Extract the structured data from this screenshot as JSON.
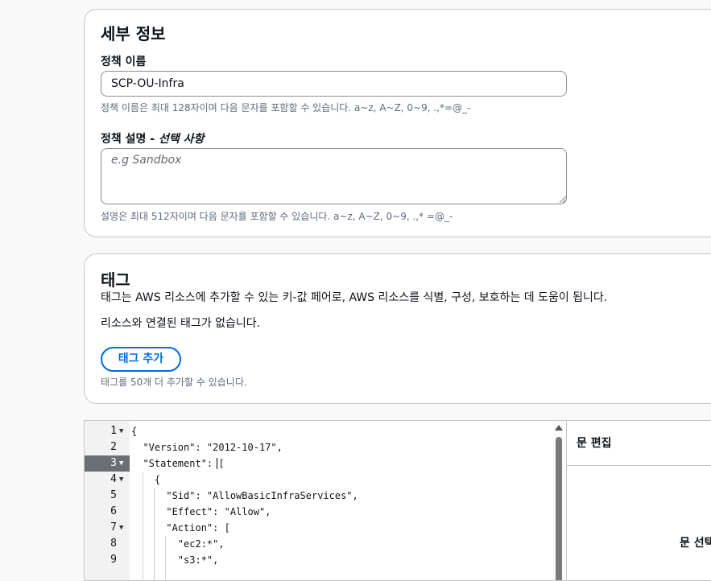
{
  "details": {
    "title": "세부 정보",
    "policy_name_label": "정책 이름",
    "policy_name_value": "SCP-OU-Infra",
    "policy_name_help": "정책 이름은 최대 128자이며 다음 문자를 포함할 수 있습니다. a~z, A~Z, 0~9, .,*=@_-",
    "description_label": "정책 설명 - ",
    "description_optional": "선택 사항",
    "description_placeholder": "e.g Sandbox",
    "description_help": "설명은 최대 512자이며 다음 문자를 포함할 수 있습니다. a~z, A~Z, 0~9, .,* =@_-"
  },
  "tags": {
    "title": "태그",
    "description": "태그는 AWS 리소스에 추가할 수 있는 키-값 페어로, AWS 리소스를 식별, 구성, 보호하는 데 도움이 됩니다.",
    "empty_text": "리소스와 연결된 태그가 없습니다.",
    "add_button": "태그 추가",
    "limit_text": "태그를 50개 더 추가할 수 있습니다."
  },
  "editor": {
    "lines": [
      {
        "no": "1",
        "text": "{"
      },
      {
        "no": "2",
        "text": "  \"Version\": \"2012-10-17\","
      },
      {
        "no": "3",
        "text": "  \"Statement\": ["
      },
      {
        "no": "4",
        "text": "    {"
      },
      {
        "no": "5",
        "text": "      \"Sid\": \"AllowBasicInfraServices\","
      },
      {
        "no": "6",
        "text": "      \"Effect\": \"Allow\","
      },
      {
        "no": "7",
        "text": "      \"Action\": ["
      },
      {
        "no": "8",
        "text": "        \"ec2:*\","
      },
      {
        "no": "9",
        "text": "        \"s3:*\","
      }
    ],
    "side_header": "문 편집",
    "side_select": "문 선택"
  }
}
